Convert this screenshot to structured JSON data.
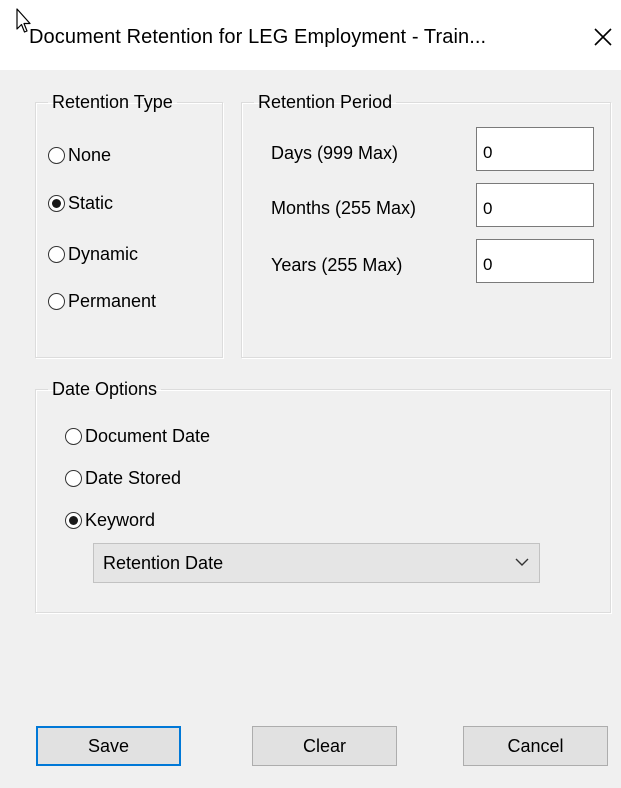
{
  "window": {
    "title": "Document Retention for LEG Employment - Train...",
    "close_glyph": "✕"
  },
  "retention_type": {
    "legend": "Retention Type",
    "options": [
      {
        "label": "None",
        "checked": false
      },
      {
        "label": "Static",
        "checked": true
      },
      {
        "label": "Dynamic",
        "checked": false
      },
      {
        "label": "Permanent",
        "checked": false
      }
    ]
  },
  "retention_period": {
    "legend": "Retention Period",
    "days_label": "Days (999 Max)",
    "days_value": "0",
    "months_label": "Months (255 Max)",
    "months_value": "0",
    "years_label": "Years (255 Max)",
    "years_value": "0"
  },
  "date_options": {
    "legend": "Date Options",
    "options": [
      {
        "label": "Document Date",
        "checked": false
      },
      {
        "label": "Date Stored",
        "checked": false
      },
      {
        "label": "Keyword",
        "checked": true
      }
    ],
    "keyword_selected": "Retention Date"
  },
  "buttons": {
    "save": "Save",
    "clear": "Clear",
    "cancel": "Cancel"
  },
  "colors": {
    "dialog_bg": "#f0f0f0",
    "default_button_border": "#0078d7"
  }
}
